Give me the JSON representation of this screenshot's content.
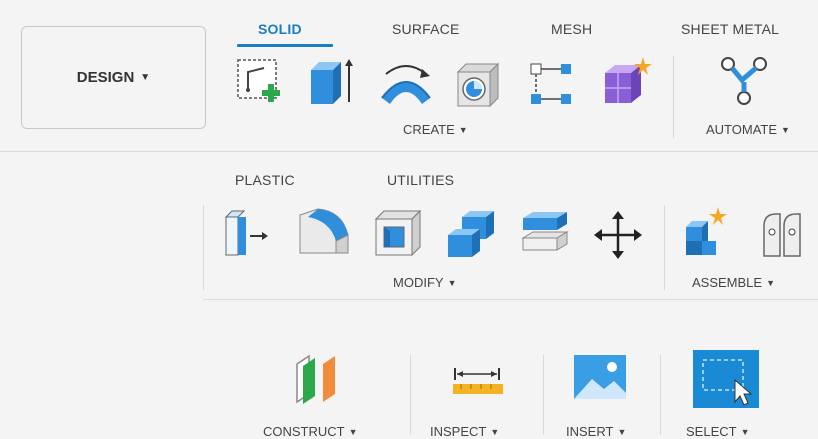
{
  "workspace": {
    "label": "DESIGN",
    "caret": "▼"
  },
  "tabs": [
    {
      "label": "SOLID",
      "active": true
    },
    {
      "label": "SURFACE",
      "active": false
    },
    {
      "label": "MESH",
      "active": false
    },
    {
      "label": "SHEET METAL",
      "active": false
    },
    {
      "label": "PLASTIC",
      "active": false
    },
    {
      "label": "UTILITIES",
      "active": false
    }
  ],
  "groups": {
    "create": {
      "label": "CREATE",
      "caret": "▼",
      "icons": [
        "sketch-icon",
        "extrude-icon",
        "revolve-icon",
        "hole-icon",
        "pattern-icon",
        "create-form-icon"
      ]
    },
    "automate": {
      "label": "AUTOMATE",
      "caret": "▼",
      "icons": [
        "automate-icon"
      ]
    },
    "modify": {
      "label": "MODIFY",
      "caret": "▼",
      "icons": [
        "press-pull-icon",
        "fillet-icon",
        "shell-icon",
        "combine-icon",
        "offset-face-icon",
        "move-icon"
      ]
    },
    "assemble": {
      "label": "ASSEMBLE",
      "caret": "▼",
      "icons": [
        "new-component-icon",
        "joint-icon"
      ]
    },
    "construct": {
      "label": "CONSTRUCT",
      "caret": "▼"
    },
    "inspect": {
      "label": "INSPECT",
      "caret": "▼"
    },
    "insert": {
      "label": "INSERT",
      "caret": "▼"
    },
    "select": {
      "label": "SELECT",
      "caret": "▼"
    }
  },
  "colors": {
    "accent": "#1a7dc4",
    "icon_blue": "#2f8fdc",
    "icon_green": "#2aa84a",
    "icon_purple": "#8a5ed6",
    "icon_orange": "#f28b3a"
  }
}
